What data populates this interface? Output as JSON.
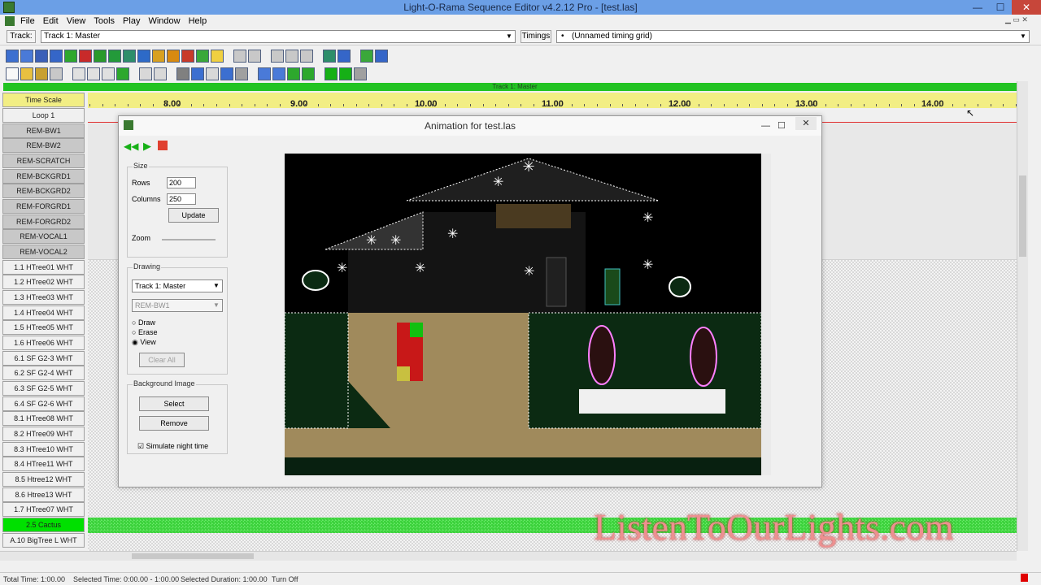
{
  "window": {
    "title": "Light-O-Rama Sequence Editor v4.2.12 Pro - [test.las]",
    "min": "—",
    "max": "☐",
    "close": "✕"
  },
  "menu": [
    "File",
    "Edit",
    "View",
    "Tools",
    "Play",
    "Window",
    "Help"
  ],
  "trackbar": {
    "track_label": "Track:",
    "track_value": "Track 1: Master",
    "timings_label": "Timings",
    "timings_value": "(Unnamed timing grid)"
  },
  "master_track": "Track 1: Master",
  "timescale": {
    "label": "Time Scale",
    "ticks": [
      "8.00",
      "9.00",
      "10.00",
      "11.00",
      "12.00",
      "13.00",
      "14.00"
    ]
  },
  "channels": [
    "Loop 1",
    "REM-BW1",
    "REM-BW2",
    "REM-SCRATCH",
    "REM-BCKGRD1",
    "REM-BCKGRD2",
    "REM-FORGRD1",
    "REM-FORGRD2",
    "REM-VOCAL1",
    "REM-VOCAL2",
    "1.1 HTree01 WHT",
    "1.2 HTree02 WHT",
    "1.3 HTree03 WHT",
    "1.4 HTree04 WHT",
    "1.5 HTree05 WHT",
    "1.6 HTree06 WHT",
    "6.1 SF G2-3 WHT",
    "6.2 SF G2-4 WHT",
    "6.3 SF G2-5 WHT",
    "6.4 SF G2-6 WHT",
    "8.1 HTree08 WHT",
    "8.2 HTree09 WHT",
    "8.3 HTree10 WHT",
    "8.4 HTree11 WHT",
    "8.5 Htree12 WHT",
    "8.6 Htree13 WHT",
    "1.7 HTree07 WHT",
    "2.5 Cactus",
    "A.10 BigTree L WHT"
  ],
  "dialog": {
    "title": "Animation for test.las",
    "size_group": "Size",
    "rows_label": "Rows",
    "rows_value": "200",
    "columns_label": "Columns",
    "columns_value": "250",
    "update": "Update",
    "zoom_label": "Zoom",
    "drawing_group": "Drawing",
    "drawing_track": "Track 1: Master",
    "drawing_channel": "REM-BW1",
    "mode_draw": "Draw",
    "mode_erase": "Erase",
    "mode_view": "View",
    "clear_all": "Clear All",
    "bg_group": "Background Image",
    "select": "Select",
    "remove": "Remove",
    "simulate": "Simulate night time"
  },
  "status": {
    "total": "Total Time: 1:00.00",
    "selected": "Selected Time: 0:00.00 - 1:00.00",
    "duration": "Selected Duration: 1:00.00",
    "turn": "Turn Off"
  },
  "watermark": "ListenToOurLights.com",
  "colors": {
    "titlebar": "#6b9fe6",
    "master_track": "#22c322",
    "timescale": "#f2ee84",
    "cactus": "#00e000"
  }
}
